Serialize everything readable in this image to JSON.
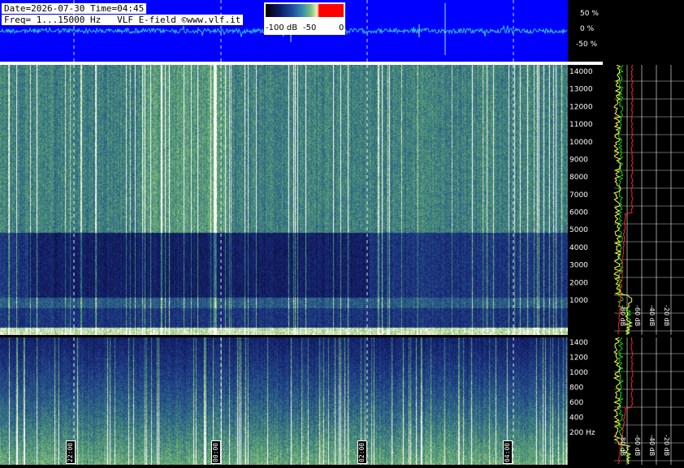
{
  "header": {
    "line1": "Date=2026-07-30 Time=04:45",
    "line2": "Freq= 1...15000 Hz   VLF E-field ©www.vlf.it"
  },
  "colorbar": {
    "labels": [
      "-100 dB",
      "-50",
      "0"
    ],
    "colors": [
      "#000000",
      "#1d4fa0",
      "#7cc07a",
      "#eef0c0",
      "#ff0000"
    ]
  },
  "waveform": {
    "scale_labels": [
      "50 %",
      "0 %",
      "-50 %"
    ],
    "background": "#0000ff",
    "trace_color": "#2ec4e0"
  },
  "freq_axis_top": {
    "ticks": [
      "14000",
      "13000",
      "12000",
      "11000",
      "10000",
      "9000",
      "8000",
      "7000",
      "6000",
      "5000",
      "4000",
      "3000",
      "2000",
      "1000"
    ]
  },
  "freq_axis_bottom": {
    "ticks": [
      "1400",
      "1200",
      "1000",
      "800",
      "600",
      "400",
      "200 Hz"
    ]
  },
  "profile_dB": {
    "labels": [
      "-80 dB",
      "-60 dB",
      "-40 dB",
      "-20 dB"
    ]
  },
  "time_labels": [
    "22:00",
    "00:00",
    "02:00",
    "04:00"
  ],
  "colors": {
    "profile_green": "#00e000",
    "profile_yellow": "#ffff40",
    "profile_red": "#ff2020",
    "grid": "#ffffff"
  }
}
